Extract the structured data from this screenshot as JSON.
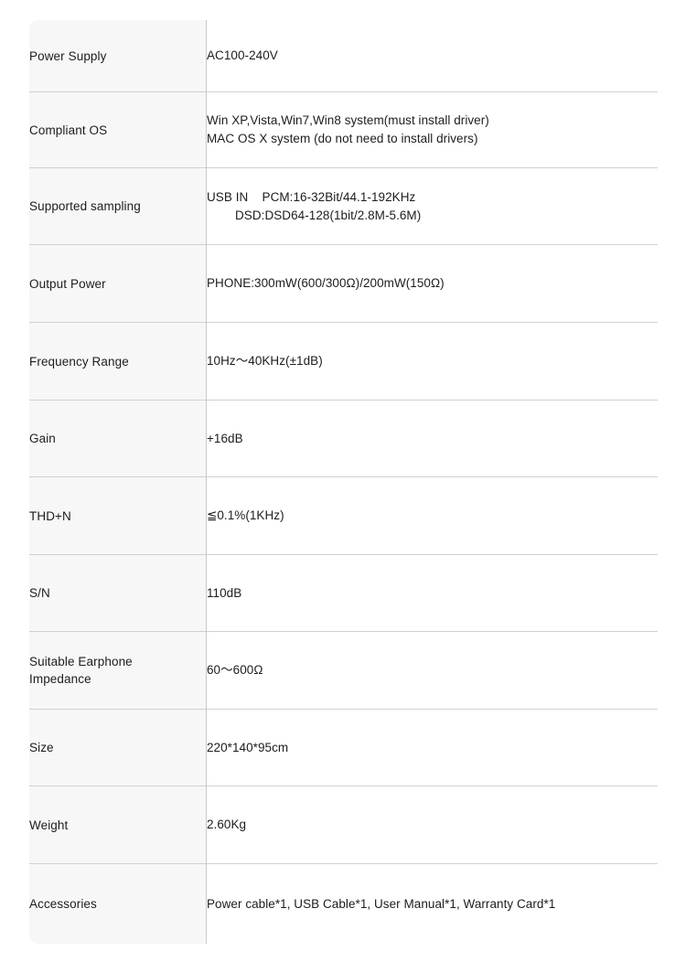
{
  "table": {
    "caption": "",
    "column_count": 2,
    "rows": [
      {
        "label": "Power Supply",
        "value_lines": [
          "AC100-240V"
        ]
      },
      {
        "label": "Compliant OS",
        "value_lines": [
          "Win XP,Vista,Win7,Win8 system(must install driver)",
          "MAC OS X system (do not need to install drivers)"
        ]
      },
      {
        "label": "Supported sampling",
        "value_lines": [
          "USB IN    PCM:16-32Bit/44.1-192KHz",
          "DSD:DSD64-128(1bit/2.8M-5.6M)"
        ],
        "indent_lines": [
          1
        ]
      },
      {
        "label": "Output Power",
        "value_lines": [
          "PHONE:300mW(600/300Ω)/200mW(150Ω)"
        ]
      },
      {
        "label": "Frequency Range",
        "value_lines": [
          "10Hz〜40KHz(±1dB)"
        ]
      },
      {
        "label": "Gain",
        "value_lines": [
          "+16dB"
        ]
      },
      {
        "label": "THD+N",
        "value_lines": [
          "≦0.1%(1KHz)"
        ]
      },
      {
        "label": "S/N",
        "value_lines": [
          "110dB"
        ]
      },
      {
        "label": "Suitable Earphone Impedance",
        "label_lines": [
          "Suitable Earphone",
          "Impedance"
        ],
        "value_lines": [
          "60〜600Ω"
        ]
      },
      {
        "label": "Size",
        "value_lines": [
          "220*140*95cm"
        ]
      },
      {
        "label": "Weight",
        "value_lines": [
          "2.60Kg"
        ]
      },
      {
        "label": "Accessories",
        "value_lines": [
          "Power cable*1, USB Cable*1, User Manual*1, Warranty Card*1"
        ]
      }
    ]
  },
  "colors": {
    "page_background": "#ffffff",
    "label_cell_background": "#f7f7f7",
    "value_cell_background": "#ffffff",
    "border": "#c9c9c9",
    "inner_divider": "#d0d0d0",
    "text": "#1d1d1d"
  }
}
